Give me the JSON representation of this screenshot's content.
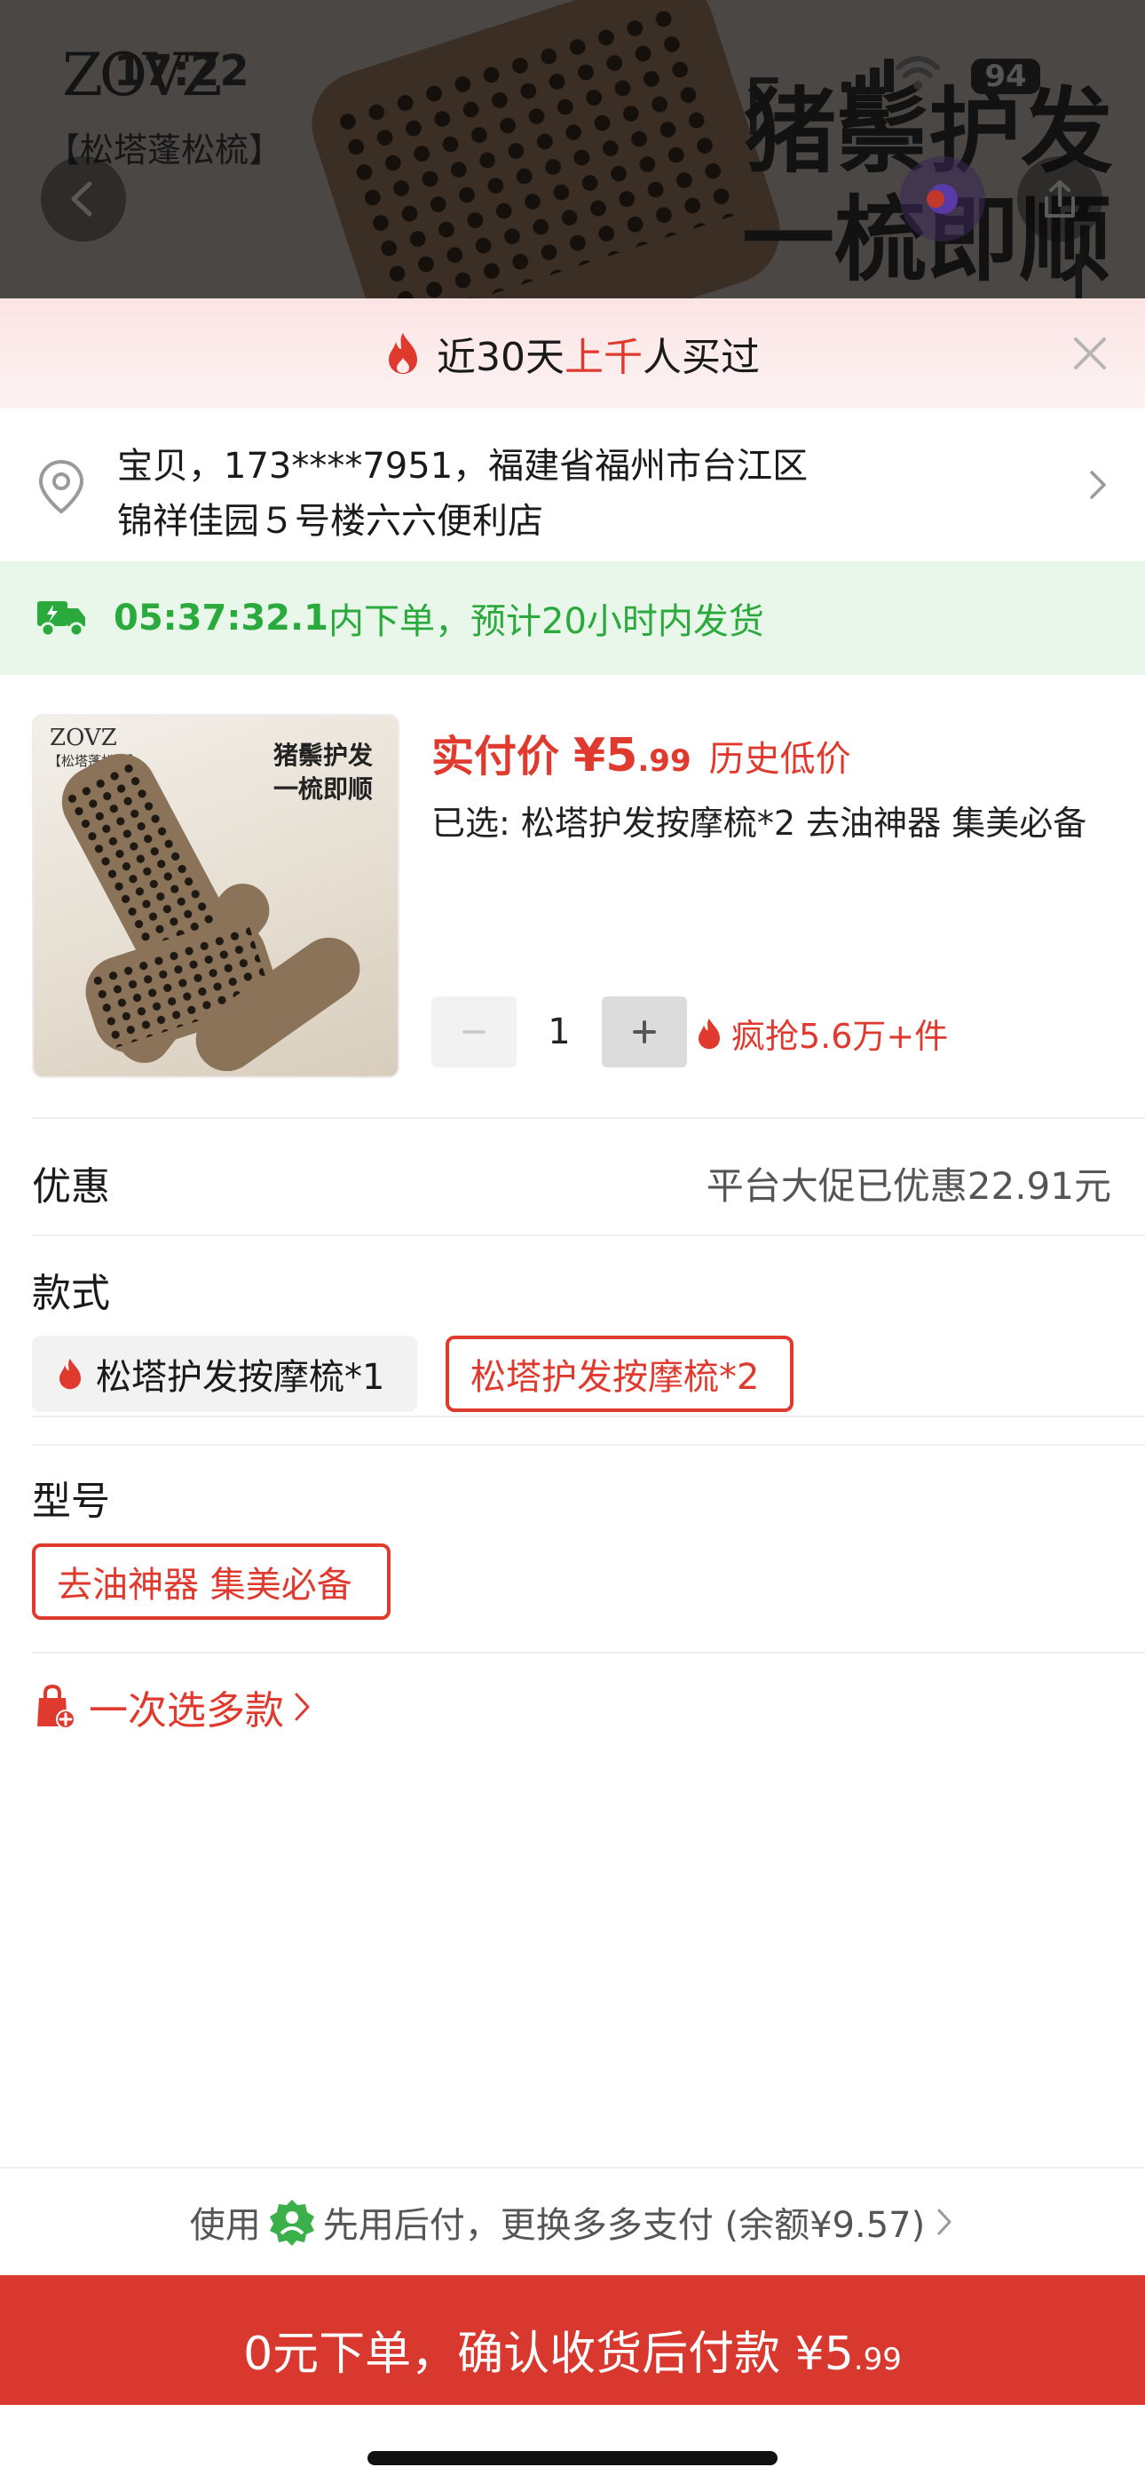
{
  "status_bar": {
    "time": "17:22",
    "battery": "94"
  },
  "background_page": {
    "logo": "ZOVZ",
    "brand": "【松塔蓬松梳】",
    "slogan_line1": "猪鬃护发",
    "slogan_line2": "一梳即顺"
  },
  "promo_banner": {
    "prefix": "近30天",
    "highlight": "上千",
    "suffix": "人买过"
  },
  "address": {
    "line1": "宝贝，173****7951，福建省福州市台江区",
    "line2": "锦祥佳园５号楼六六便利店"
  },
  "delivery": {
    "countdown": "05:37:32.1",
    "text": "内下单，预计20小时内发货"
  },
  "product": {
    "thumb_logo": "ZOVZ",
    "thumb_brand": "【松塔蓬松梳】",
    "thumb_slogan_1": "猪鬃护发",
    "thumb_slogan_2": "一梳即顺",
    "price_label": "实付价",
    "price_main": "¥5",
    "price_decimal": ".99",
    "price_tag": "历史低价",
    "selected": "已选: 松塔护发按摩梳*2 去油神器 集美必备",
    "quantity": "1",
    "hot_sale": "疯抢5.6万+件"
  },
  "discount": {
    "label": "优惠",
    "value": "平台大促已优惠22.91元"
  },
  "style": {
    "label": "款式",
    "options": [
      "松塔护发按摩梳*1",
      "松塔护发按摩梳*2"
    ],
    "selected_index": 1
  },
  "model": {
    "label": "型号",
    "options": [
      "去油神器 集美必备"
    ],
    "selected_index": 0
  },
  "multi_select": {
    "label": "一次选多款"
  },
  "payment": {
    "prefix": "使用",
    "text": "先用后付，更换多多支付 (余额¥9.57)"
  },
  "cta": {
    "main": "0元下单，确认收货后付款 ¥5",
    "decimal": ".99"
  },
  "colors": {
    "accent": "#e03a2f",
    "cta_bg": "#d9382e",
    "delivery_green": "#2aa93c",
    "promo_bg": "#fbe4e4"
  },
  "icons": [
    "back-arrow-icon",
    "share-icon",
    "fire-icon",
    "close-icon",
    "location-pin-icon",
    "chevron-right-icon",
    "delivery-truck-icon",
    "minus-icon",
    "plus-icon",
    "shopping-bag-plus-icon",
    "pay-later-leaf-icon"
  ]
}
